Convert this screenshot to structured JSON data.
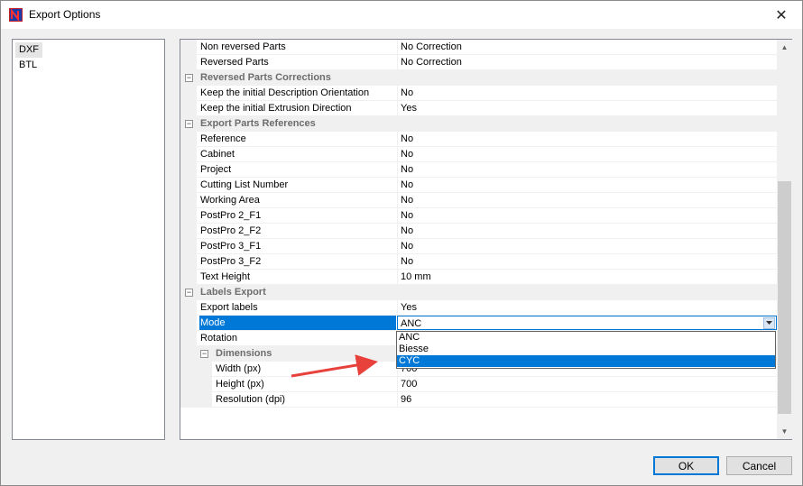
{
  "window": {
    "title": "Export Options"
  },
  "tree": {
    "items": [
      "DXF",
      "BTL"
    ]
  },
  "grid": {
    "rows": [
      {
        "type": "prop",
        "name": "Non reversed Parts",
        "value": "No Correction"
      },
      {
        "type": "prop",
        "name": "Reversed Parts",
        "value": "No Correction"
      },
      {
        "type": "cat",
        "name": "Reversed Parts Corrections"
      },
      {
        "type": "prop",
        "name": "Keep the initial Description Orientation",
        "value": "No"
      },
      {
        "type": "prop",
        "name": "Keep the initial Extrusion Direction",
        "value": "Yes"
      },
      {
        "type": "cat",
        "name": "Export Parts References"
      },
      {
        "type": "prop",
        "name": "Reference",
        "value": "No"
      },
      {
        "type": "prop",
        "name": "Cabinet",
        "value": "No"
      },
      {
        "type": "prop",
        "name": "Project",
        "value": "No"
      },
      {
        "type": "prop",
        "name": "Cutting List Number",
        "value": "No"
      },
      {
        "type": "prop",
        "name": "Working Area",
        "value": "No"
      },
      {
        "type": "prop",
        "name": "PostPro 2_F1",
        "value": "No"
      },
      {
        "type": "prop",
        "name": "PostPro 2_F2",
        "value": "No"
      },
      {
        "type": "prop",
        "name": "PostPro 3_F1",
        "value": "No"
      },
      {
        "type": "prop",
        "name": "PostPro 3_F2",
        "value": "No"
      },
      {
        "type": "prop",
        "name": "Text Height",
        "value": "10 mm"
      },
      {
        "type": "cat",
        "name": "Labels Export"
      },
      {
        "type": "prop",
        "name": "Export labels",
        "value": "Yes"
      },
      {
        "type": "prop",
        "name": "Mode",
        "value": "ANC",
        "selected": true
      },
      {
        "type": "prop",
        "name": "Rotation",
        "value": ""
      },
      {
        "type": "subcat",
        "name": "Dimensions"
      },
      {
        "type": "prop2",
        "name": "Width (px)",
        "value": "700"
      },
      {
        "type": "prop2",
        "name": "Height (px)",
        "value": "700"
      },
      {
        "type": "prop2",
        "name": "Resolution (dpi)",
        "value": "96"
      }
    ]
  },
  "dropdown": {
    "options": [
      "ANC",
      "Biesse",
      "CYC"
    ],
    "highlighted": "CYC"
  },
  "buttons": {
    "ok": "OK",
    "cancel": "Cancel"
  },
  "colors": {
    "selection": "#0078d7",
    "arrow": "#e8413c",
    "category_text": "#6d6d6d"
  }
}
